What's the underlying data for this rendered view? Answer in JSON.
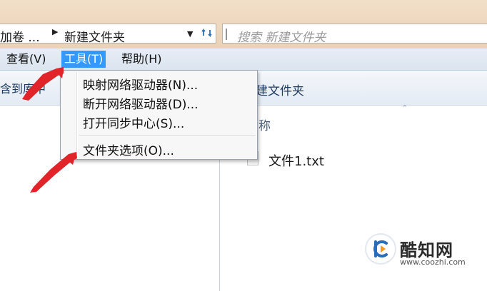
{
  "address_bar": {
    "crumb_truncated": "加卷 ...",
    "crumb_current": "新建文件夹"
  },
  "search": {
    "placeholder": "搜索 新建文件夹"
  },
  "menubar": {
    "items": [
      {
        "label": "查看(V)",
        "active": false
      },
      {
        "label": "工具(T)",
        "active": true
      },
      {
        "label": "帮助(H)",
        "active": false
      }
    ]
  },
  "tools_menu": {
    "items": [
      {
        "label": "映射网络驱动器(N)..."
      },
      {
        "label": "断开网络驱动器(D)..."
      },
      {
        "label": "打开同步中心(S)..."
      },
      {
        "label": "文件夹选项(O)..."
      }
    ]
  },
  "nav_pane": {
    "header_text": "含到库中"
  },
  "content_pane": {
    "title": "建文件夹",
    "column_name": "称",
    "files": [
      {
        "name": "文件1.txt"
      }
    ]
  },
  "watermark": {
    "name": "酷知网",
    "url": "www.coozhi.com"
  },
  "colors": {
    "menu_highlight": "#3399ff",
    "annotation_arrow": "#e0242a",
    "top_band": "#ead2b6",
    "menubar_bg": "#dbe4ef"
  },
  "icons": [
    "chevron-right-icon",
    "dropdown-arrow-icon",
    "refresh-icon",
    "search-icon",
    "file-icon",
    "coozhi-logo",
    "annotation-arrow"
  ]
}
